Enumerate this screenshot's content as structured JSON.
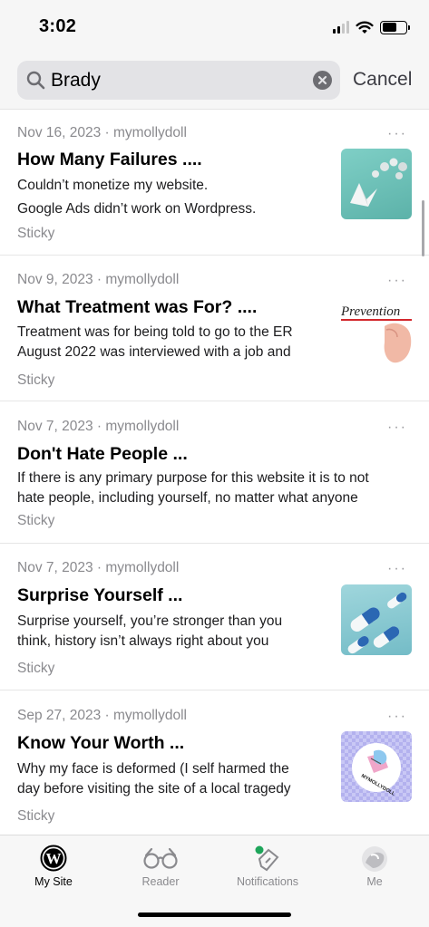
{
  "status_bar": {
    "time": "3:02"
  },
  "search": {
    "query": "Brady",
    "cancel_label": "Cancel"
  },
  "posts": [
    {
      "meta": "Nov 16, 2023 · mymollydoll",
      "title": "How Many Failures ....",
      "line1": "Couldn’t monetize my website.",
      "line2": "Google Ads didn’t work on Wordpress.",
      "tag": "Sticky",
      "thumbnail": "paper-crane-image"
    },
    {
      "meta": "Nov 9, 2023 · mymollydoll",
      "title": "What Treatment was For? ....",
      "line1": "Treatment was for being told to go to the ER",
      "line2": "August 2022 was interviewed with a job and",
      "tag": "Sticky",
      "thumbnail": "prevention-image",
      "thumbnail_text": "Prevention"
    },
    {
      "meta": "Nov 7, 2023 · mymollydoll",
      "title": "Don't Hate People ...",
      "line1": "If there is any primary purpose for this website it is to not",
      "line2": "hate people, including yourself, no matter what anyone",
      "tag": "Sticky"
    },
    {
      "meta": "Nov 7, 2023 · mymollydoll",
      "title": "Surprise Yourself ...",
      "line1": "Surprise yourself, you’re stronger than you",
      "line2": "think, history isn’t always right about you",
      "tag": "Sticky",
      "thumbnail": "capsules-image"
    },
    {
      "meta": "Sep 27, 2023 · mymollydoll",
      "title": "Know Your Worth ...",
      "line1": "Why my face is deformed (I self harmed the",
      "line2": "day before visiting the site of a local tragedy",
      "tag": "Sticky",
      "thumbnail": "mymollydoll-logo",
      "thumbnail_text": "MYMOLLYDOLL"
    }
  ],
  "more_glyph": "···",
  "tabs": [
    {
      "label": "My Site",
      "icon": "wordpress-icon",
      "active": true
    },
    {
      "label": "Reader",
      "icon": "glasses-icon",
      "active": false
    },
    {
      "label": "Notifications",
      "icon": "notifications-icon",
      "active": false,
      "badge_color": "#1ea55a"
    },
    {
      "label": "Me",
      "icon": "avatar-icon",
      "active": false
    }
  ],
  "colors": {
    "accent_text": "#000000",
    "secondary_text": "#8a8a8e",
    "badge_green": "#1ea55a"
  }
}
